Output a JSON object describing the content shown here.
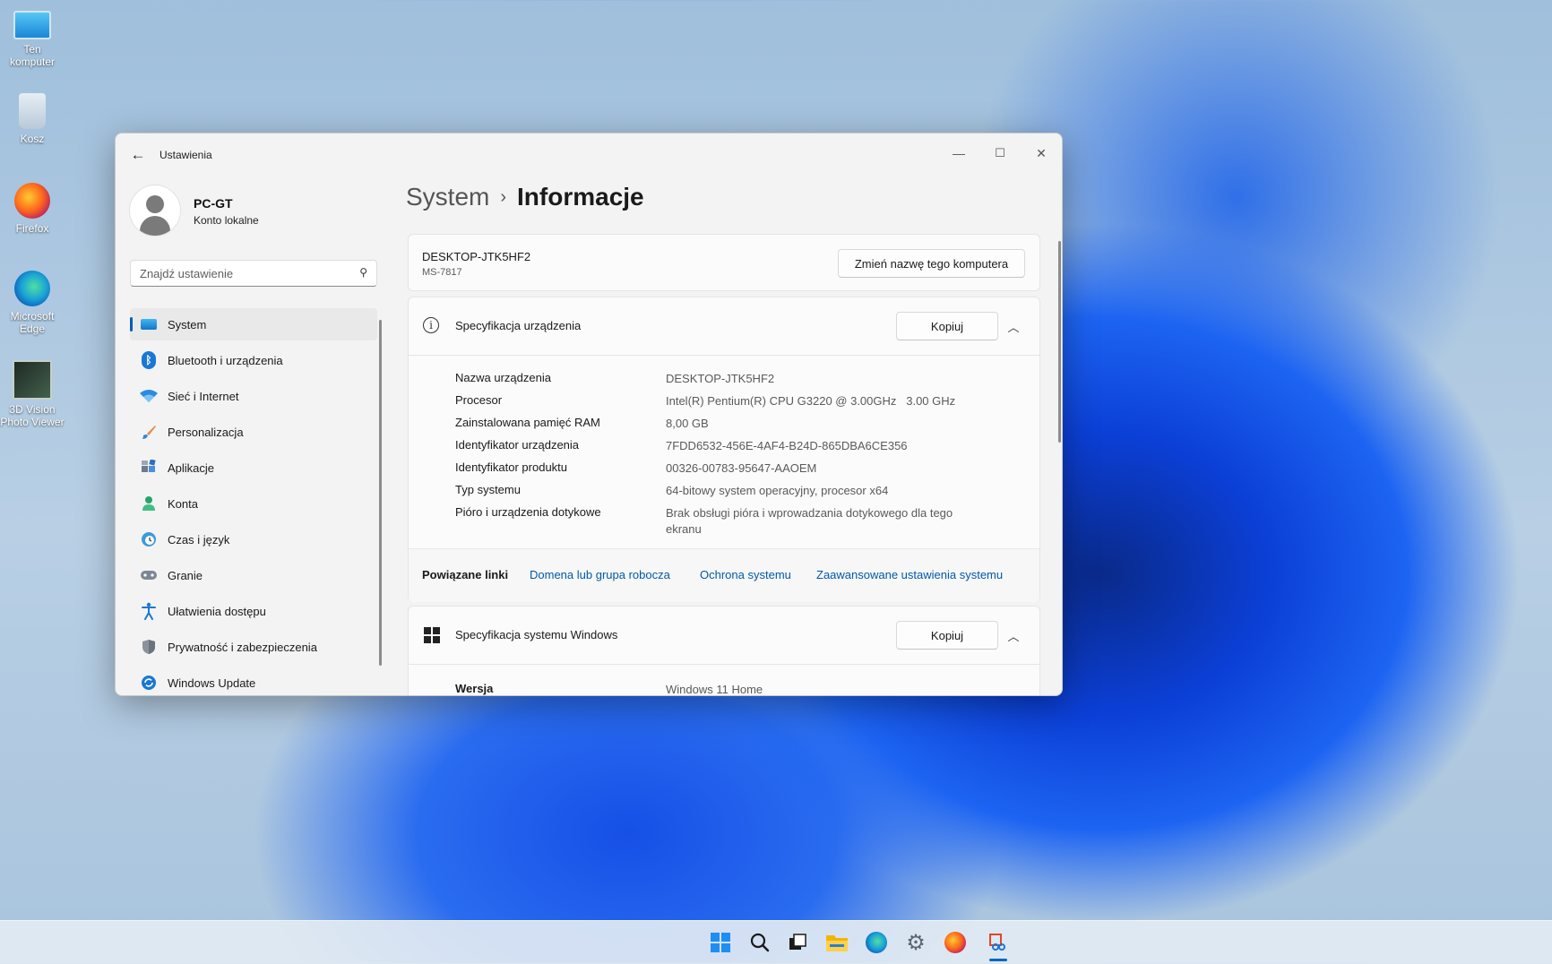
{
  "desktop": {
    "icons": [
      {
        "label": "Ten komputer",
        "icon": "monitor-icon"
      },
      {
        "label": "Kosz",
        "icon": "recycle-bin-icon"
      },
      {
        "label": "Firefox",
        "icon": "firefox-icon"
      },
      {
        "label": "Microsoft Edge",
        "icon": "edge-icon"
      },
      {
        "label": "3D Vision Photo Viewer",
        "icon": "3d-vision-icon"
      }
    ]
  },
  "window": {
    "title": "Ustawienia",
    "controls": {
      "minimize": "—",
      "maximize": "☐",
      "close": "✕"
    }
  },
  "user": {
    "name": "PC-GT",
    "account_type": "Konto lokalne"
  },
  "search": {
    "placeholder": "Znajdź ustawienie"
  },
  "sidebar": {
    "items": [
      {
        "label": "System",
        "icon": "monitor-icon",
        "active": true
      },
      {
        "label": "Bluetooth i urządzenia",
        "icon": "bluetooth-icon"
      },
      {
        "label": "Sieć i Internet",
        "icon": "wifi-icon"
      },
      {
        "label": "Personalizacja",
        "icon": "brush-icon"
      },
      {
        "label": "Aplikacje",
        "icon": "apps-icon"
      },
      {
        "label": "Konta",
        "icon": "person-icon"
      },
      {
        "label": "Czas i język",
        "icon": "globe-clock-icon"
      },
      {
        "label": "Granie",
        "icon": "gamepad-icon"
      },
      {
        "label": "Ułatwienia dostępu",
        "icon": "accessibility-icon"
      },
      {
        "label": "Prywatność i zabezpieczenia",
        "icon": "shield-icon"
      },
      {
        "label": "Windows Update",
        "icon": "update-icon"
      }
    ]
  },
  "breadcrumb": {
    "parent": "System",
    "separator": "›",
    "current": "Informacje"
  },
  "device_card": {
    "name": "DESKTOP-JTK5HF2",
    "model": "MS-7817",
    "rename_button": "Zmień nazwę tego komputera"
  },
  "device_spec": {
    "title": "Specyfikacja urządzenia",
    "copy_button": "Kopiuj",
    "rows": [
      {
        "key": "Nazwa urządzenia",
        "value": "DESKTOP-JTK5HF2"
      },
      {
        "key": "Procesor",
        "value": "Intel(R) Pentium(R) CPU G3220 @ 3.00GHz   3.00 GHz"
      },
      {
        "key": "Zainstalowana pamięć RAM",
        "value": "8,00 GB"
      },
      {
        "key": "Identyfikator urządzenia",
        "value": "7FDD6532-456E-4AF4-B24D-865DBA6CE356"
      },
      {
        "key": "Identyfikator produktu",
        "value": "00326-00783-95647-AAOEM"
      },
      {
        "key": "Typ systemu",
        "value": "64-bitowy system operacyjny, procesor x64"
      },
      {
        "key": "Pióro i urządzenia dotykowe",
        "value": "Brak obsługi pióra i wprowadzania dotykowego dla tego ekranu"
      }
    ]
  },
  "related_links": {
    "label": "Powiązane linki",
    "links": [
      "Domena lub grupa robocza",
      "Ochrona systemu",
      "Zaawansowane ustawienia systemu"
    ]
  },
  "windows_spec": {
    "title": "Specyfikacja systemu Windows",
    "copy_button": "Kopiuj",
    "rows": [
      {
        "key": "Wersja",
        "value": "Windows 11 Home"
      }
    ]
  },
  "taskbar": {
    "items": [
      "start-icon",
      "search-icon",
      "task-view-icon",
      "file-explorer-icon",
      "edge-icon",
      "settings-icon",
      "firefox-icon",
      "snipping-tool-icon"
    ]
  },
  "colors": {
    "accent": "#005fb8",
    "link": "#005aa8"
  }
}
